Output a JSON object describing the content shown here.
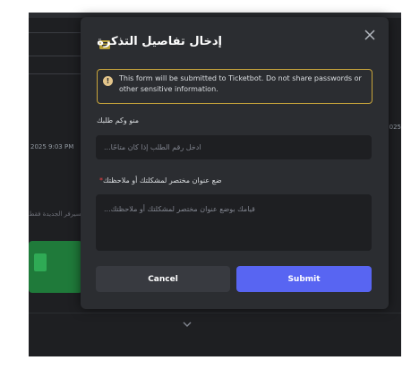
{
  "modal": {
    "title": "إدخال تفاصيل التذكرة",
    "notice": "This form will be submitted to Ticketbot. Do not share passwords or other sensitive information.",
    "fields": [
      {
        "label": "منو وكم طلبك",
        "placeholder": "ادخل رقم الطلب إذا كان متاحًا...",
        "required": false
      },
      {
        "label": "ضع عنوان مختصر لمشكلتك أو ملاحظتك",
        "placeholder": "قيامك بوضع عنوان مختصر لمشكلتك أو ملاحظتك...",
        "required": true,
        "required_mark": "*"
      }
    ],
    "cancel_label": "Cancel",
    "submit_label": "Submit"
  },
  "background": {
    "timestamp": "2025 9:03 PM",
    "timestamp_right": "025",
    "arabic_snippet": "أساس السيرفر الجديدة فقط"
  },
  "colors": {
    "modal_bg": "#2b2d31",
    "field_bg": "#1e1f22",
    "notice_border": "#c9a53b",
    "submit": "#5865f2",
    "cancel": "#383a40",
    "required": "#f23f43"
  }
}
